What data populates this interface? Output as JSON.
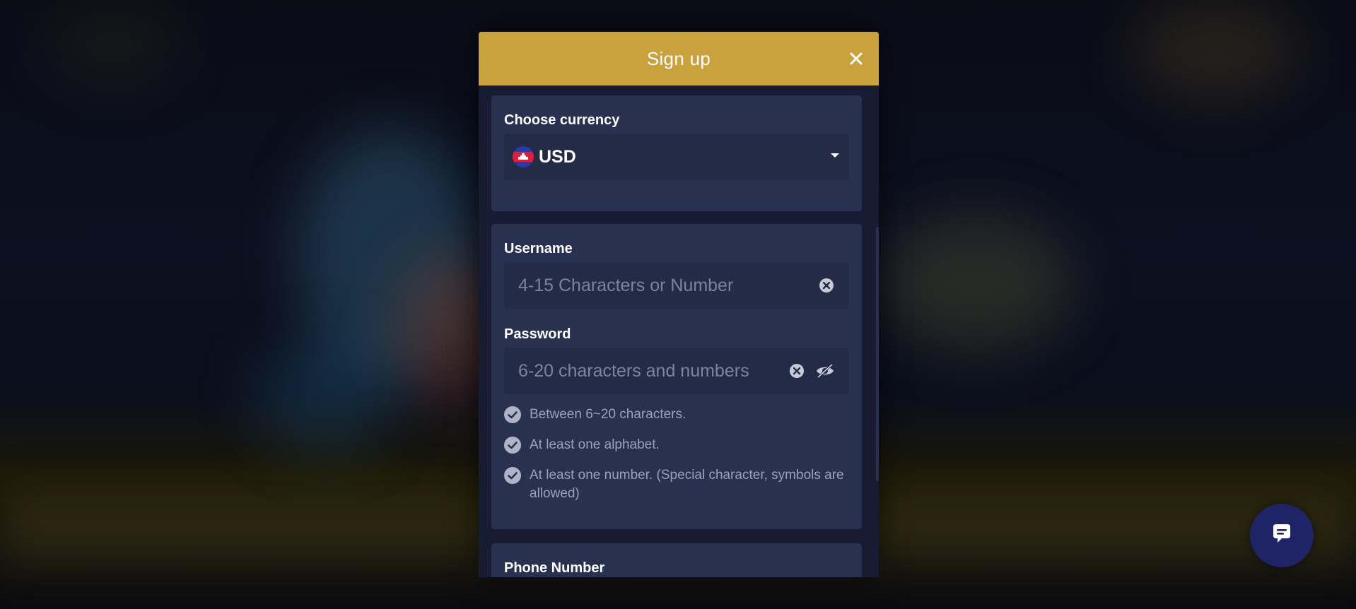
{
  "modal": {
    "title": "Sign up",
    "close_icon": "close-icon"
  },
  "currency": {
    "label": "Choose currency",
    "selected": "USD",
    "flag_icon": "cambodia-flag-icon"
  },
  "username": {
    "label": "Username",
    "placeholder": "4-15 Characters or Number",
    "value": ""
  },
  "password": {
    "label": "Password",
    "placeholder": "6-20 characters and numbers",
    "value": ""
  },
  "password_rules": [
    {
      "text": "Between 6~20 characters."
    },
    {
      "text": "At least one alphabet."
    },
    {
      "text": "At least one number. (Special character, symbols are allowed)"
    }
  ],
  "phone": {
    "label": "Phone Number"
  },
  "chat": {
    "icon": "chat-bubble-icon"
  },
  "colors": {
    "header_gold": "#c9a23e",
    "card_bg": "#283150",
    "field_bg": "#232b47",
    "chat_button": "#1e2465"
  }
}
